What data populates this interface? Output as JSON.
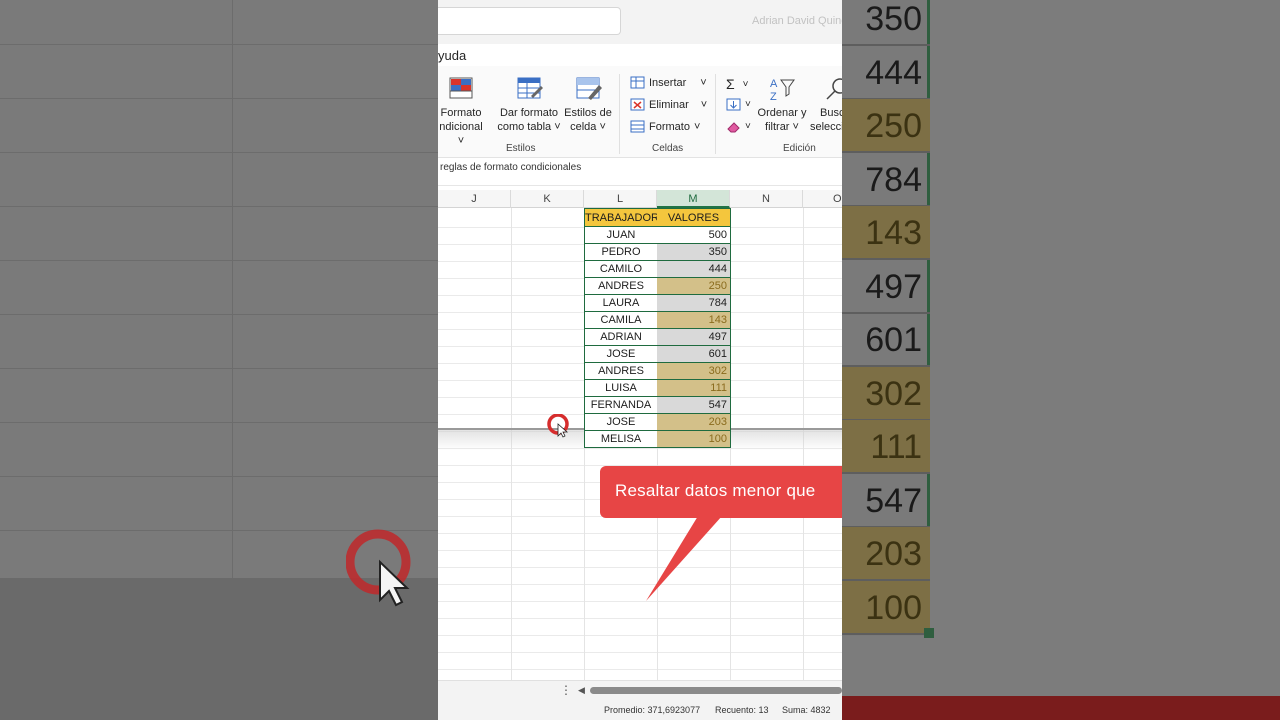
{
  "window": {
    "user_name": "Adrian David Quinc",
    "menu_tab": "yuda"
  },
  "ribbon": {
    "cond_format": [
      "Formato",
      "ndicional"
    ],
    "format_table": [
      "Dar formato",
      "como tabla"
    ],
    "cell_styles": [
      "Estilos de",
      "celda"
    ],
    "insert": "Insertar",
    "delete": "Eliminar",
    "format": "Formato",
    "sort_filter": [
      "Ordenar y",
      "filtrar"
    ],
    "find_select": [
      "Busc",
      "selecci"
    ],
    "groups": {
      "styles": "Estilos",
      "cells": "Celdas",
      "editing": "Edición"
    }
  },
  "formula_bar": {
    "text": "reglas de formato condicionales"
  },
  "columns": {
    "J": "J",
    "K": "K",
    "L": "L",
    "M": "M",
    "N": "N",
    "O": "O"
  },
  "table": {
    "header_name": "TRABAJADOR",
    "header_value": "VALORES",
    "rows": [
      {
        "name": "JUAN",
        "value": "500",
        "highlight": false
      },
      {
        "name": "PEDRO",
        "value": "350",
        "highlight": false
      },
      {
        "name": "CAMILO",
        "value": "444",
        "highlight": false
      },
      {
        "name": "ANDRES",
        "value": "250",
        "highlight": true
      },
      {
        "name": "LAURA",
        "value": "784",
        "highlight": false
      },
      {
        "name": "CAMILA",
        "value": "143",
        "highlight": true
      },
      {
        "name": "ADRIAN",
        "value": "497",
        "highlight": false
      },
      {
        "name": "JOSE",
        "value": "601",
        "highlight": false
      },
      {
        "name": "ANDRES",
        "value": "302",
        "highlight": true
      },
      {
        "name": "LUISA",
        "value": "111",
        "highlight": true
      },
      {
        "name": "FERNANDA",
        "value": "547",
        "highlight": false
      },
      {
        "name": "JOSE",
        "value": "203",
        "highlight": true
      },
      {
        "name": "MELISA",
        "value": "100",
        "highlight": true
      }
    ]
  },
  "callout": {
    "text": "Resaltar datos menor que"
  },
  "background_zoom": {
    "values": [
      {
        "value": "350",
        "highlight": false
      },
      {
        "value": "444",
        "highlight": false
      },
      {
        "value": "250",
        "highlight": true
      },
      {
        "value": "784",
        "highlight": false
      },
      {
        "value": "143",
        "highlight": true
      },
      {
        "value": "497",
        "highlight": false
      },
      {
        "value": "601",
        "highlight": false
      },
      {
        "value": "302",
        "highlight": true
      },
      {
        "value": "111",
        "highlight": true
      },
      {
        "value": "547",
        "highlight": false
      },
      {
        "value": "203",
        "highlight": true
      },
      {
        "value": "100",
        "highlight": true
      }
    ]
  },
  "status_bar": {
    "average": "Promedio: 371,6923077",
    "count": "Recuento: 13",
    "sum": "Suma: 4832"
  },
  "colors": {
    "header_yellow": "#f4c63d",
    "normal_fill": "#d9d9d9",
    "low_fill": "#d3c089",
    "low_text": "#8a6b1d",
    "excel_green": "#217346",
    "callout_red": "#e74545"
  }
}
